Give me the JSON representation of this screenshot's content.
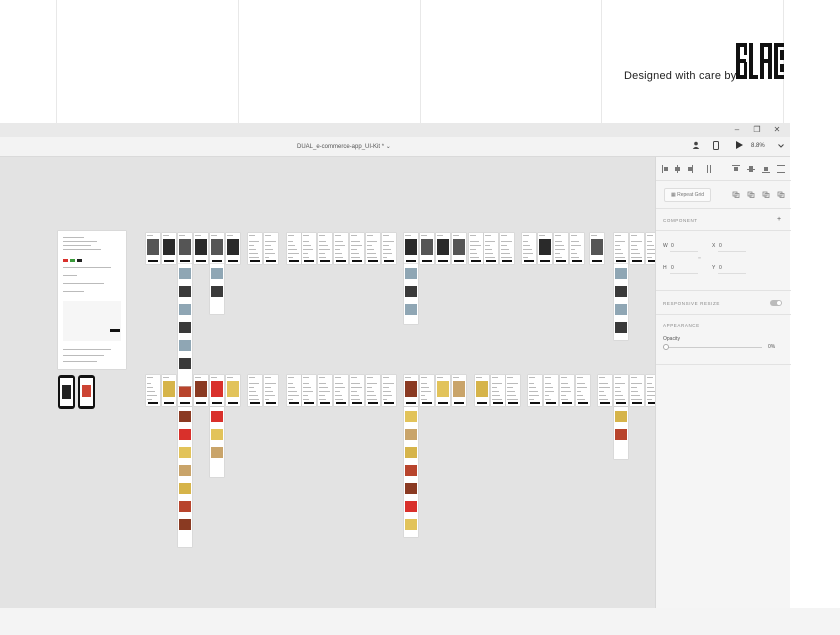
{
  "presentation": {
    "credit_text": "Designed with care by",
    "logo_name": "black-logo"
  },
  "window": {
    "title": "DUAL_e-commerce-app_UI-Kit *",
    "controls": {
      "minimize": "–",
      "restore": "❐",
      "close": "✕"
    },
    "zoom": "8.8%",
    "icons": [
      "user-icon",
      "mobile-preview-icon",
      "play-icon",
      "chevron-down-icon"
    ]
  },
  "panel": {
    "repeat_grid_label": "Repeat Grid",
    "component_label": "COMPONENT",
    "add_symbol": "+",
    "w_label": "W",
    "w_value": "0",
    "h_label": "H",
    "h_value": "0",
    "x_label": "X",
    "x_value": "0",
    "y_label": "Y",
    "y_value": "0",
    "responsive_label": "RESPONSIVE RESIZE",
    "appearance_label": "APPEARANCE",
    "opacity_label": "Opacity",
    "opacity_value": "0%"
  },
  "colors": {
    "accent_red": "#d9302b",
    "canvas_bg": "#e3e3e3",
    "panel_bg": "#f5f5f5"
  }
}
